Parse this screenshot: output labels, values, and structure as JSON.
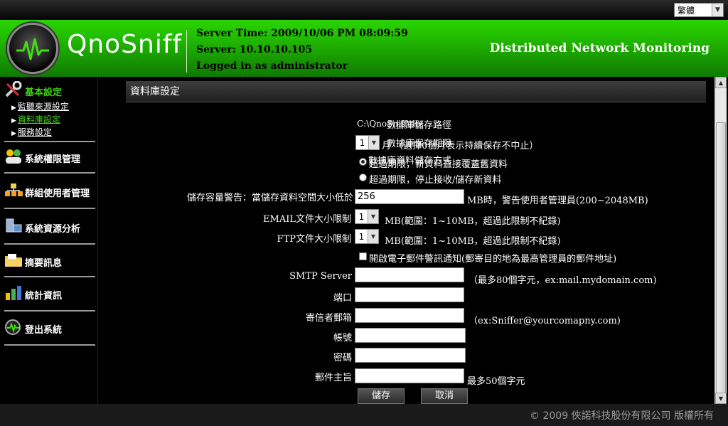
{
  "top": {
    "language": "繁體"
  },
  "header": {
    "logo_text": "QnoSniff",
    "server_time": "Server Time: 2009/10/06 PM 08:09:59",
    "server": "Server: 10.10.10.105",
    "logged_in": "Logged in as administrator",
    "tagline": "Distributed Network Monitoring"
  },
  "sidebar": {
    "basic": {
      "title": "基本設定",
      "items": [
        "監聽來源設定",
        "資料庫設定",
        "服務設定"
      ]
    },
    "perm": "系統權限管理",
    "group": "群組使用者管理",
    "resource": "系統資源分析",
    "summary": "摘要訊息",
    "stats": "統計資訊",
    "logout": "登出系統"
  },
  "content": {
    "title": "資料庫設定",
    "db_path_label": "數據庫儲存路徑",
    "db_path_value": "C:\\QnoSniff\\db",
    "db_retention_label": "數據庫保存期限",
    "db_retention_value": "1",
    "db_retention_note": "月 （選擇0個月表示持續保存不中止）",
    "storage_mode_label": "數據庫資料儲存方式",
    "storage_mode_opt1": "超過期限，新資料直接覆蓋舊資料",
    "storage_mode_opt2": "超過期限，停止接收/儲存新資料",
    "capacity_label": "儲存容量警告：當儲存資料空間大小低於",
    "capacity_value": "256",
    "capacity_note": "MB時，警告使用者管理員(200~2048MB)",
    "email_limit_label": "EMAIL文件大小限制",
    "email_limit_value": "1",
    "email_limit_note": "MB(範圍：1~10MB，超過此限制不紀錄)",
    "ftp_limit_label": "FTP文件大小限制",
    "ftp_limit_value": "1",
    "ftp_limit_note": "MB(範圍：1~10MB，超過此限制不紀錄)",
    "email_alert_label": "開啟電子郵件警訊通知(郵寄目的地為最高管理員的郵件地址)",
    "smtp_label": "SMTP Server",
    "smtp_note": "（最多80個字元，ex:mail.mydomain.com)",
    "port_label": "端口",
    "sender_label": "寄信者郵箱",
    "sender_note": "（ex:Sniffer@yourcomapny.com)",
    "account_label": "帳號",
    "password_label": "密碼",
    "subject_label": "郵件主旨",
    "subject_note": "最多50個字元",
    "save_label": "儲存",
    "cancel_label": "取消"
  },
  "footer": {
    "copyright": "© 2009 俠諾科技股份有限公司 版權所有"
  }
}
